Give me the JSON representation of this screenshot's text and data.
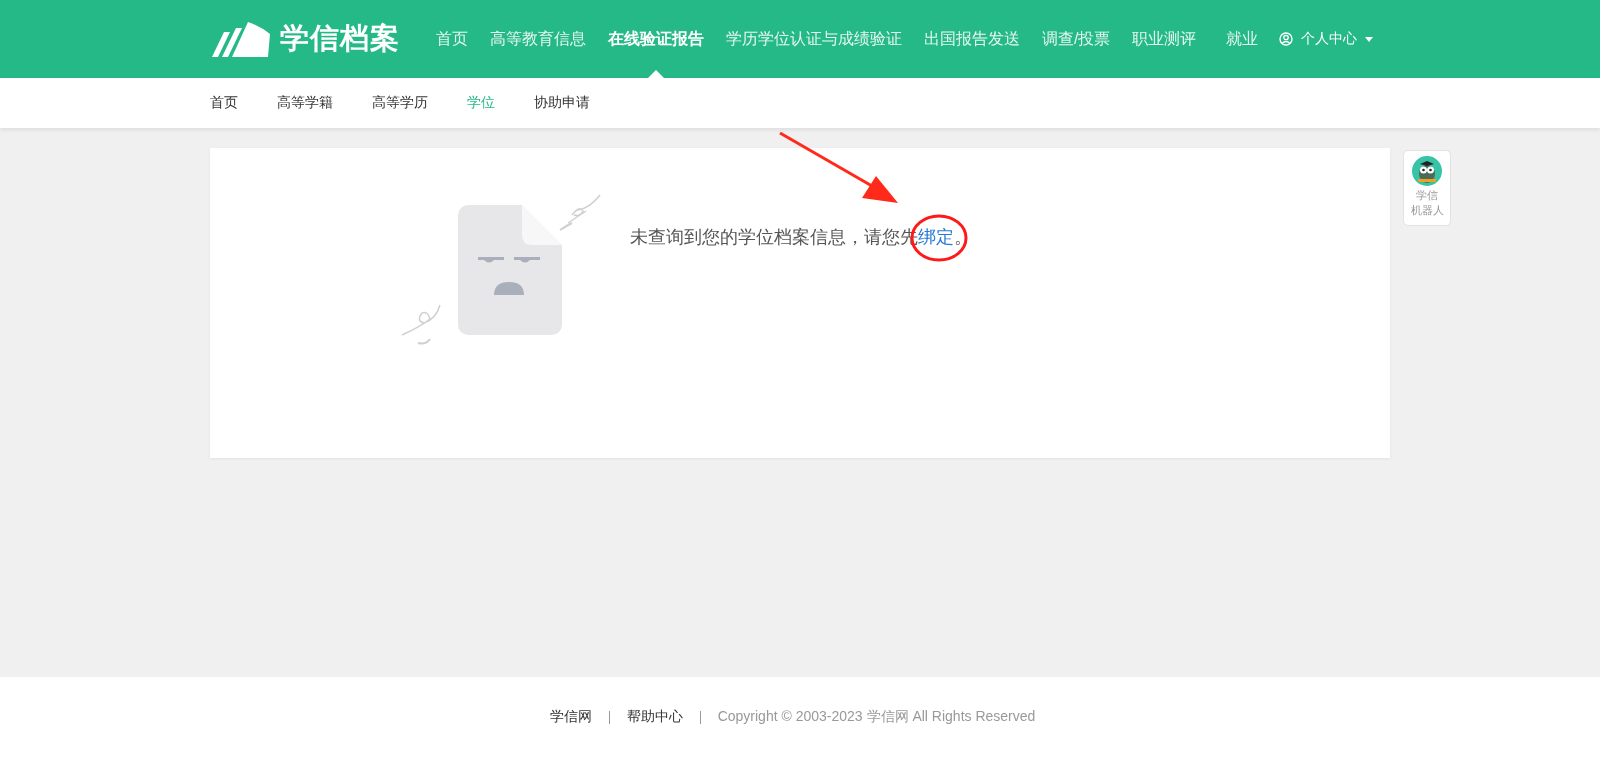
{
  "header": {
    "logo": "学信档案",
    "nav": [
      {
        "label": "首页",
        "selected": false
      },
      {
        "label": "高等教育信息",
        "selected": false
      },
      {
        "label": "在线验证报告",
        "selected": true
      },
      {
        "label": "学历学位认证与成绩验证",
        "selected": false
      },
      {
        "label": "出国报告发送",
        "selected": false
      },
      {
        "label": "调查/投票",
        "selected": false
      },
      {
        "label": "职业测评",
        "selected": false
      },
      {
        "label": "就业",
        "selected": false
      }
    ],
    "user_menu": "个人中心"
  },
  "subnav": [
    {
      "label": "首页",
      "selected": false
    },
    {
      "label": "高等学籍",
      "selected": false
    },
    {
      "label": "高等学历",
      "selected": false
    },
    {
      "label": "学位",
      "selected": true
    },
    {
      "label": "协助申请",
      "selected": false
    }
  ],
  "empty_state": {
    "message": "未查询到您的学位档案信息，请您先",
    "link": "绑定",
    "end": "。"
  },
  "robot": {
    "lines": [
      "学信",
      "机器人"
    ]
  },
  "footer": {
    "links": [
      "学信网",
      "帮助中心"
    ],
    "copyright": "Copyright © 2003-2023 学信网 All Rights Reserved"
  }
}
